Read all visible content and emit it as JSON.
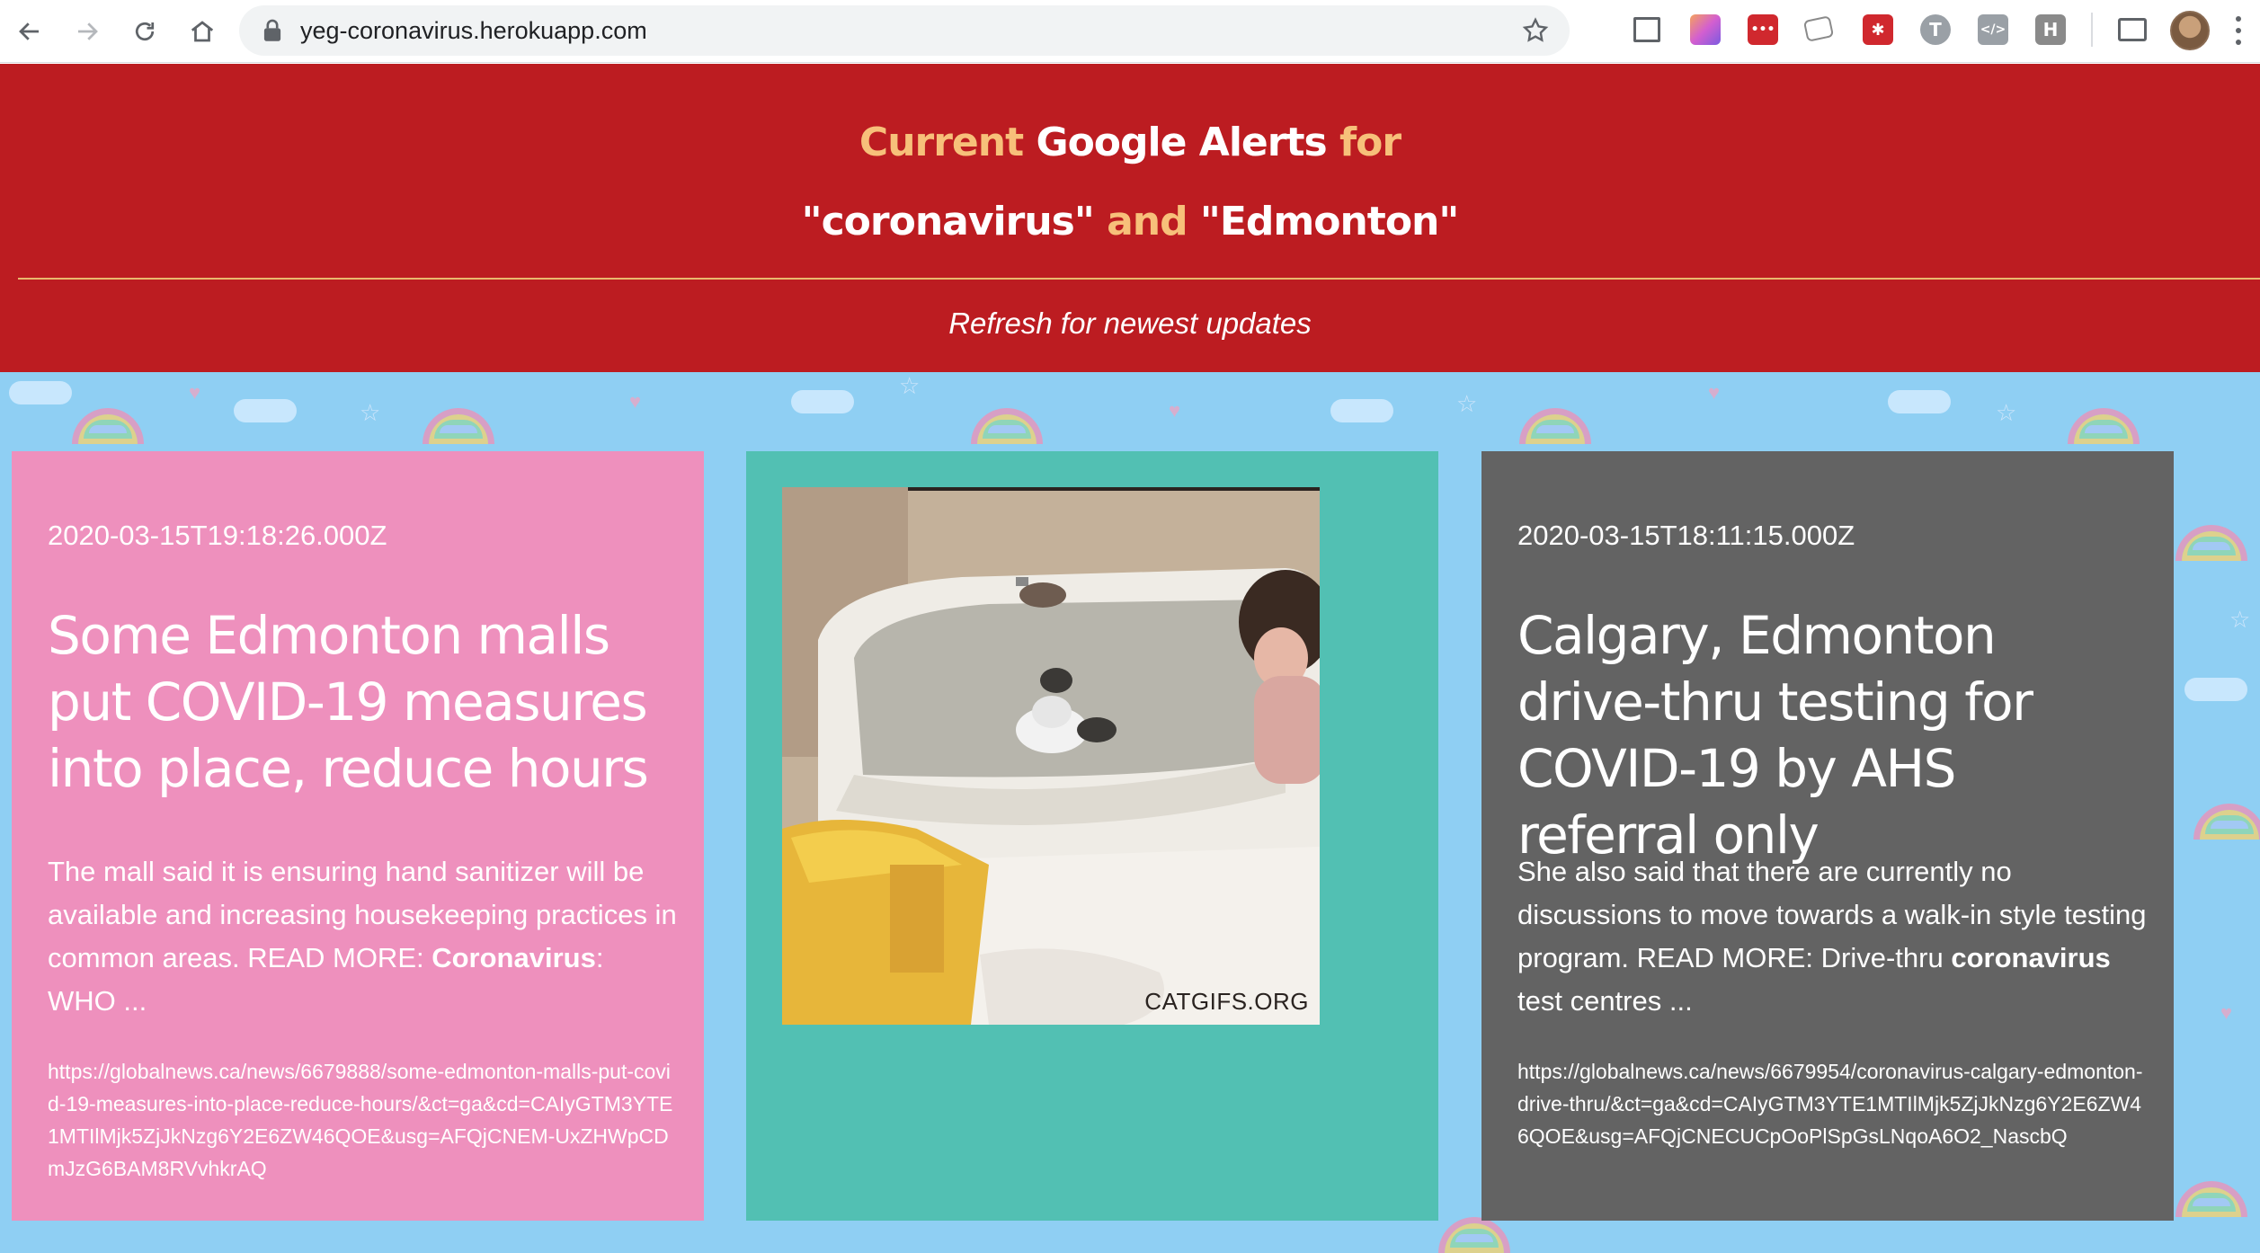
{
  "browser": {
    "url": "yeg-coronavirus.herokuapp.com",
    "icons": {
      "back": "arrow-left-icon",
      "forward": "arrow-right-icon",
      "reload": "reload-icon",
      "home": "home-icon",
      "lock": "lock-icon",
      "bookmark": "star-icon"
    },
    "extensions": [
      {
        "name": "screenshot-extension-icon",
        "glyph": "",
        "color": "#5f6368"
      },
      {
        "name": "gradient-extension-icon",
        "glyph": "",
        "color": "#d35fd0"
      },
      {
        "name": "dots-extension-icon",
        "glyph": "•••",
        "color": "#d0282e"
      },
      {
        "name": "notepad-extension-icon",
        "glyph": "",
        "color": "#8a8a8a"
      },
      {
        "name": "bug-extension-icon",
        "glyph": "",
        "color": "#d0282e"
      },
      {
        "name": "t-extension-icon",
        "glyph": "T",
        "color": "#9aa0a6"
      },
      {
        "name": "code-extension-icon",
        "glyph": "</>",
        "color": "#9aa0a6"
      },
      {
        "name": "h-extension-icon",
        "glyph": "H",
        "color": "#8a8a8a"
      }
    ]
  },
  "header": {
    "line1": [
      "Current",
      "Google Alerts",
      "for"
    ],
    "line2": [
      "\"coronavirus\"",
      "and",
      "\"Edmonton\""
    ],
    "subtitle": "Refresh for newest updates",
    "colors": {
      "background": "#bc1c21",
      "accent": "#f7c07a",
      "rule": "#e9b86e"
    }
  },
  "cards": [
    {
      "color": "#ee90bd",
      "timestamp": "2020-03-15T19:18:26.000Z",
      "title": "Some Edmonton malls put COVID-19 measures into place, reduce hours",
      "snippet_pre": "The mall said it is ensuring hand sanitizer will be available and increasing housekeeping practices in common areas. READ MORE: ",
      "snippet_bold": "Coronavirus",
      "snippet_post": ": WHO ...",
      "url": "https://globalnews.ca/news/6679888/some-edmonton-malls-put-covid-19-measures-into-place-reduce-hours/&ct=ga&cd=CAIyGTM3YTE1MTIlMjk5ZjJkNzg6Y2E6ZW46QOE&usg=AFQjCNEM-UxZHWpCDmJzG6BAM8RVvhkrAQ"
    },
    {
      "color": "#52c0b3",
      "watermark": "CATGIFS.ORG"
    },
    {
      "color": "#636363",
      "timestamp": "2020-03-15T18:11:15.000Z",
      "title": "Calgary, Edmonton drive-thru testing for COVID-19 by AHS referral only",
      "snippet_pre": "She also said that there are currently no discussions to move towards a walk-in style testing program. READ MORE: Drive-thru ",
      "snippet_bold": "coronavirus",
      "snippet_post": " test centres ...",
      "url": "https://globalnews.ca/news/6679954/coronavirus-calgary-edmonton-drive-thru/&ct=ga&cd=CAIyGTM3YTE1MTIlMjk5ZjJkNzg6Y2E6ZW46QOE&usg=AFQjCNECUCpOoPlSpGsLNqoA6O2_NascbQ"
    }
  ],
  "background_color": "#8fcff3"
}
